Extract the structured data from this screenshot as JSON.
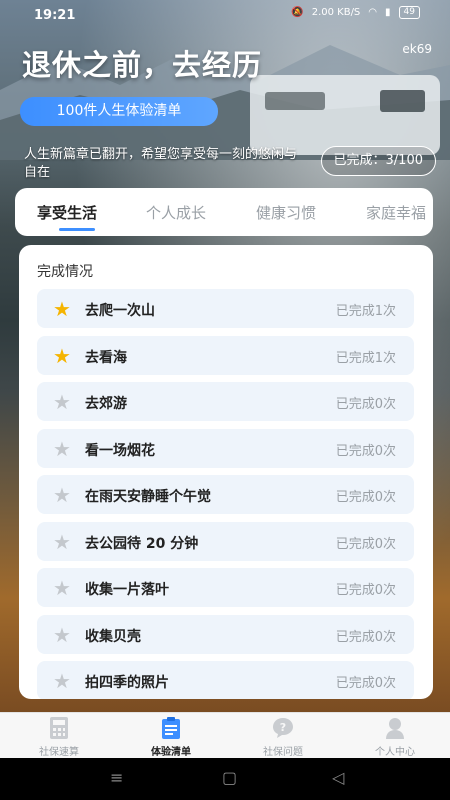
{
  "status_bar": {
    "time": "19:21",
    "network_speed": "2.00 KB/S",
    "battery": "49"
  },
  "header": {
    "title": "退休之前，去经历",
    "watermark": "ek69",
    "pill_label": "100件人生体验清单",
    "subtitle": "人生新篇章已翻开，希望您享受每一刻的悠闲与自在",
    "completed_label": "已完成：3/100"
  },
  "tabs": [
    {
      "label": "享受生活",
      "active": true
    },
    {
      "label": "个人成长",
      "active": false
    },
    {
      "label": "健康习惯",
      "active": false
    },
    {
      "label": "家庭幸福",
      "active": false
    }
  ],
  "panel": {
    "title": "完成情况",
    "items": [
      {
        "label": "去爬一次山",
        "count": "已完成1次",
        "done": true
      },
      {
        "label": "去看海",
        "count": "已完成1次",
        "done": true
      },
      {
        "label": "去郊游",
        "count": "已完成0次",
        "done": false
      },
      {
        "label": "看一场烟花",
        "count": "已完成0次",
        "done": false
      },
      {
        "label": "在雨天安静睡个午觉",
        "count": "已完成0次",
        "done": false
      },
      {
        "label": "去公园待 20 分钟",
        "count": "已完成0次",
        "done": false
      },
      {
        "label": "收集一片落叶",
        "count": "已完成0次",
        "done": false
      },
      {
        "label": "收集贝壳",
        "count": "已完成0次",
        "done": false
      },
      {
        "label": "拍四季的照片",
        "count": "已完成0次",
        "done": false
      }
    ]
  },
  "bottom_nav": [
    {
      "label": "社保速算",
      "icon": "calculator-icon",
      "active": false
    },
    {
      "label": "体验清单",
      "icon": "clipboard-icon",
      "active": true
    },
    {
      "label": "社保问题",
      "icon": "question-icon",
      "active": false
    },
    {
      "label": "个人中心",
      "icon": "user-icon",
      "active": false
    }
  ],
  "colors": {
    "accent": "#3d8fff",
    "star_on": "#f5b400",
    "star_off": "#c4c8cd"
  }
}
